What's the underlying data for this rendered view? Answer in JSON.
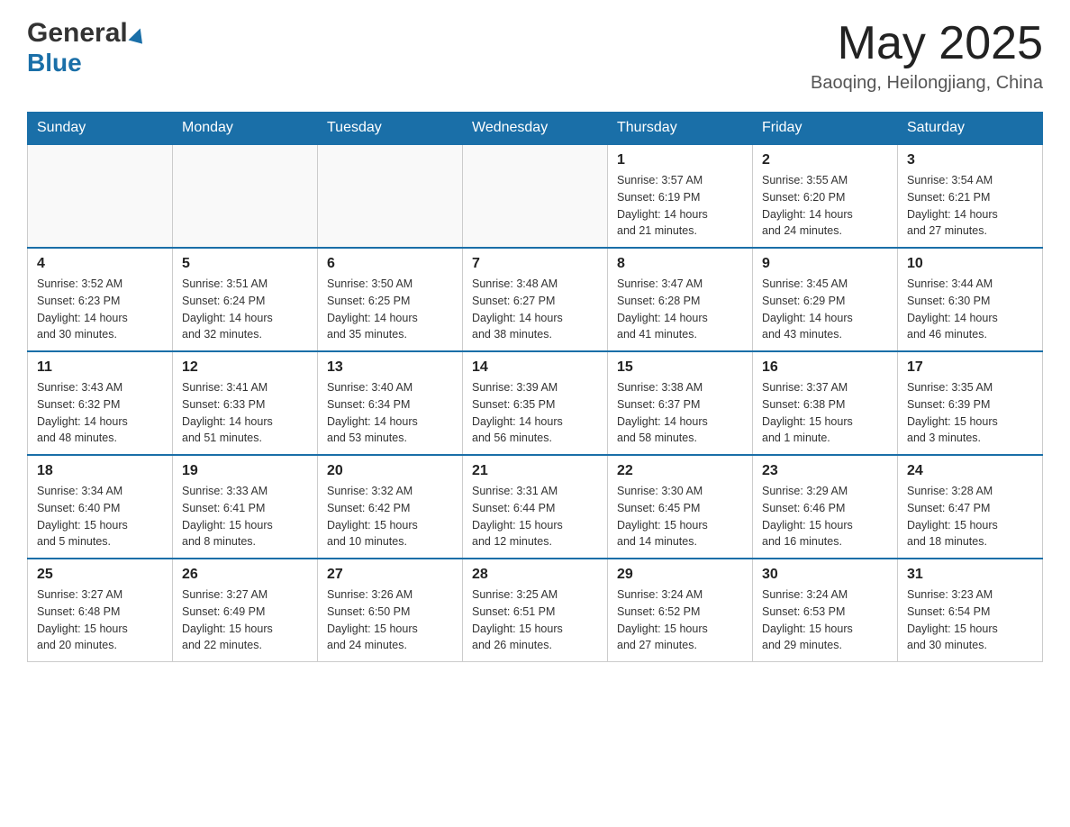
{
  "header": {
    "logo_general": "General",
    "logo_blue": "Blue",
    "month_year": "May 2025",
    "location": "Baoqing, Heilongjiang, China"
  },
  "weekdays": [
    "Sunday",
    "Monday",
    "Tuesday",
    "Wednesday",
    "Thursday",
    "Friday",
    "Saturday"
  ],
  "weeks": [
    [
      {
        "day": "",
        "info": ""
      },
      {
        "day": "",
        "info": ""
      },
      {
        "day": "",
        "info": ""
      },
      {
        "day": "",
        "info": ""
      },
      {
        "day": "1",
        "info": "Sunrise: 3:57 AM\nSunset: 6:19 PM\nDaylight: 14 hours\nand 21 minutes."
      },
      {
        "day": "2",
        "info": "Sunrise: 3:55 AM\nSunset: 6:20 PM\nDaylight: 14 hours\nand 24 minutes."
      },
      {
        "day": "3",
        "info": "Sunrise: 3:54 AM\nSunset: 6:21 PM\nDaylight: 14 hours\nand 27 minutes."
      }
    ],
    [
      {
        "day": "4",
        "info": "Sunrise: 3:52 AM\nSunset: 6:23 PM\nDaylight: 14 hours\nand 30 minutes."
      },
      {
        "day": "5",
        "info": "Sunrise: 3:51 AM\nSunset: 6:24 PM\nDaylight: 14 hours\nand 32 minutes."
      },
      {
        "day": "6",
        "info": "Sunrise: 3:50 AM\nSunset: 6:25 PM\nDaylight: 14 hours\nand 35 minutes."
      },
      {
        "day": "7",
        "info": "Sunrise: 3:48 AM\nSunset: 6:27 PM\nDaylight: 14 hours\nand 38 minutes."
      },
      {
        "day": "8",
        "info": "Sunrise: 3:47 AM\nSunset: 6:28 PM\nDaylight: 14 hours\nand 41 minutes."
      },
      {
        "day": "9",
        "info": "Sunrise: 3:45 AM\nSunset: 6:29 PM\nDaylight: 14 hours\nand 43 minutes."
      },
      {
        "day": "10",
        "info": "Sunrise: 3:44 AM\nSunset: 6:30 PM\nDaylight: 14 hours\nand 46 minutes."
      }
    ],
    [
      {
        "day": "11",
        "info": "Sunrise: 3:43 AM\nSunset: 6:32 PM\nDaylight: 14 hours\nand 48 minutes."
      },
      {
        "day": "12",
        "info": "Sunrise: 3:41 AM\nSunset: 6:33 PM\nDaylight: 14 hours\nand 51 minutes."
      },
      {
        "day": "13",
        "info": "Sunrise: 3:40 AM\nSunset: 6:34 PM\nDaylight: 14 hours\nand 53 minutes."
      },
      {
        "day": "14",
        "info": "Sunrise: 3:39 AM\nSunset: 6:35 PM\nDaylight: 14 hours\nand 56 minutes."
      },
      {
        "day": "15",
        "info": "Sunrise: 3:38 AM\nSunset: 6:37 PM\nDaylight: 14 hours\nand 58 minutes."
      },
      {
        "day": "16",
        "info": "Sunrise: 3:37 AM\nSunset: 6:38 PM\nDaylight: 15 hours\nand 1 minute."
      },
      {
        "day": "17",
        "info": "Sunrise: 3:35 AM\nSunset: 6:39 PM\nDaylight: 15 hours\nand 3 minutes."
      }
    ],
    [
      {
        "day": "18",
        "info": "Sunrise: 3:34 AM\nSunset: 6:40 PM\nDaylight: 15 hours\nand 5 minutes."
      },
      {
        "day": "19",
        "info": "Sunrise: 3:33 AM\nSunset: 6:41 PM\nDaylight: 15 hours\nand 8 minutes."
      },
      {
        "day": "20",
        "info": "Sunrise: 3:32 AM\nSunset: 6:42 PM\nDaylight: 15 hours\nand 10 minutes."
      },
      {
        "day": "21",
        "info": "Sunrise: 3:31 AM\nSunset: 6:44 PM\nDaylight: 15 hours\nand 12 minutes."
      },
      {
        "day": "22",
        "info": "Sunrise: 3:30 AM\nSunset: 6:45 PM\nDaylight: 15 hours\nand 14 minutes."
      },
      {
        "day": "23",
        "info": "Sunrise: 3:29 AM\nSunset: 6:46 PM\nDaylight: 15 hours\nand 16 minutes."
      },
      {
        "day": "24",
        "info": "Sunrise: 3:28 AM\nSunset: 6:47 PM\nDaylight: 15 hours\nand 18 minutes."
      }
    ],
    [
      {
        "day": "25",
        "info": "Sunrise: 3:27 AM\nSunset: 6:48 PM\nDaylight: 15 hours\nand 20 minutes."
      },
      {
        "day": "26",
        "info": "Sunrise: 3:27 AM\nSunset: 6:49 PM\nDaylight: 15 hours\nand 22 minutes."
      },
      {
        "day": "27",
        "info": "Sunrise: 3:26 AM\nSunset: 6:50 PM\nDaylight: 15 hours\nand 24 minutes."
      },
      {
        "day": "28",
        "info": "Sunrise: 3:25 AM\nSunset: 6:51 PM\nDaylight: 15 hours\nand 26 minutes."
      },
      {
        "day": "29",
        "info": "Sunrise: 3:24 AM\nSunset: 6:52 PM\nDaylight: 15 hours\nand 27 minutes."
      },
      {
        "day": "30",
        "info": "Sunrise: 3:24 AM\nSunset: 6:53 PM\nDaylight: 15 hours\nand 29 minutes."
      },
      {
        "day": "31",
        "info": "Sunrise: 3:23 AM\nSunset: 6:54 PM\nDaylight: 15 hours\nand 30 minutes."
      }
    ]
  ]
}
